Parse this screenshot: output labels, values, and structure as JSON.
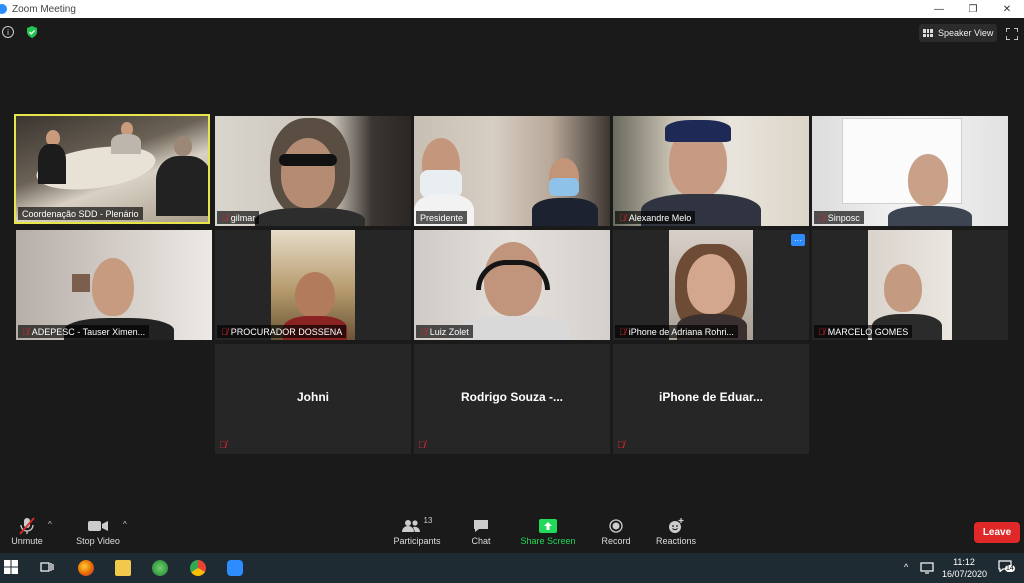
{
  "window": {
    "title": "Zoom Meeting"
  },
  "header": {
    "speaker_view_label": "Speaker View"
  },
  "tiles": [
    {
      "name": "Coordenação SDD - Plenário",
      "active": true
    },
    {
      "name": "gilmar"
    },
    {
      "name": "Presidente"
    },
    {
      "name": "Alexandre Melo"
    },
    {
      "name": "Sinposc"
    },
    {
      "name": "ADEPESC - Tauser Ximen..."
    },
    {
      "name": "PROCURADOR DOSSENA"
    },
    {
      "name": "Luiz Zolet"
    },
    {
      "name": "iPhone de Adriana Rohri..."
    },
    {
      "name": "MARCELO GOMES"
    },
    {
      "name": "Johni"
    },
    {
      "name": "Rodrigo Souza -..."
    },
    {
      "name": "iPhone de Eduar..."
    }
  ],
  "toolbar": {
    "unmute": "Unmute",
    "stop_video": "Stop Video",
    "participants": "Participants",
    "participants_count": "13",
    "chat": "Chat",
    "share_screen": "Share Screen",
    "record": "Record",
    "reactions": "Reactions",
    "leave": "Leave"
  },
  "taskbar": {
    "time": "11:12",
    "date": "16/07/2020",
    "notifications": "14"
  },
  "colors": {
    "accent": "#2d8cff",
    "share_green": "#23d959",
    "leave_red": "#e02828",
    "active_border": "#e6e64a"
  }
}
